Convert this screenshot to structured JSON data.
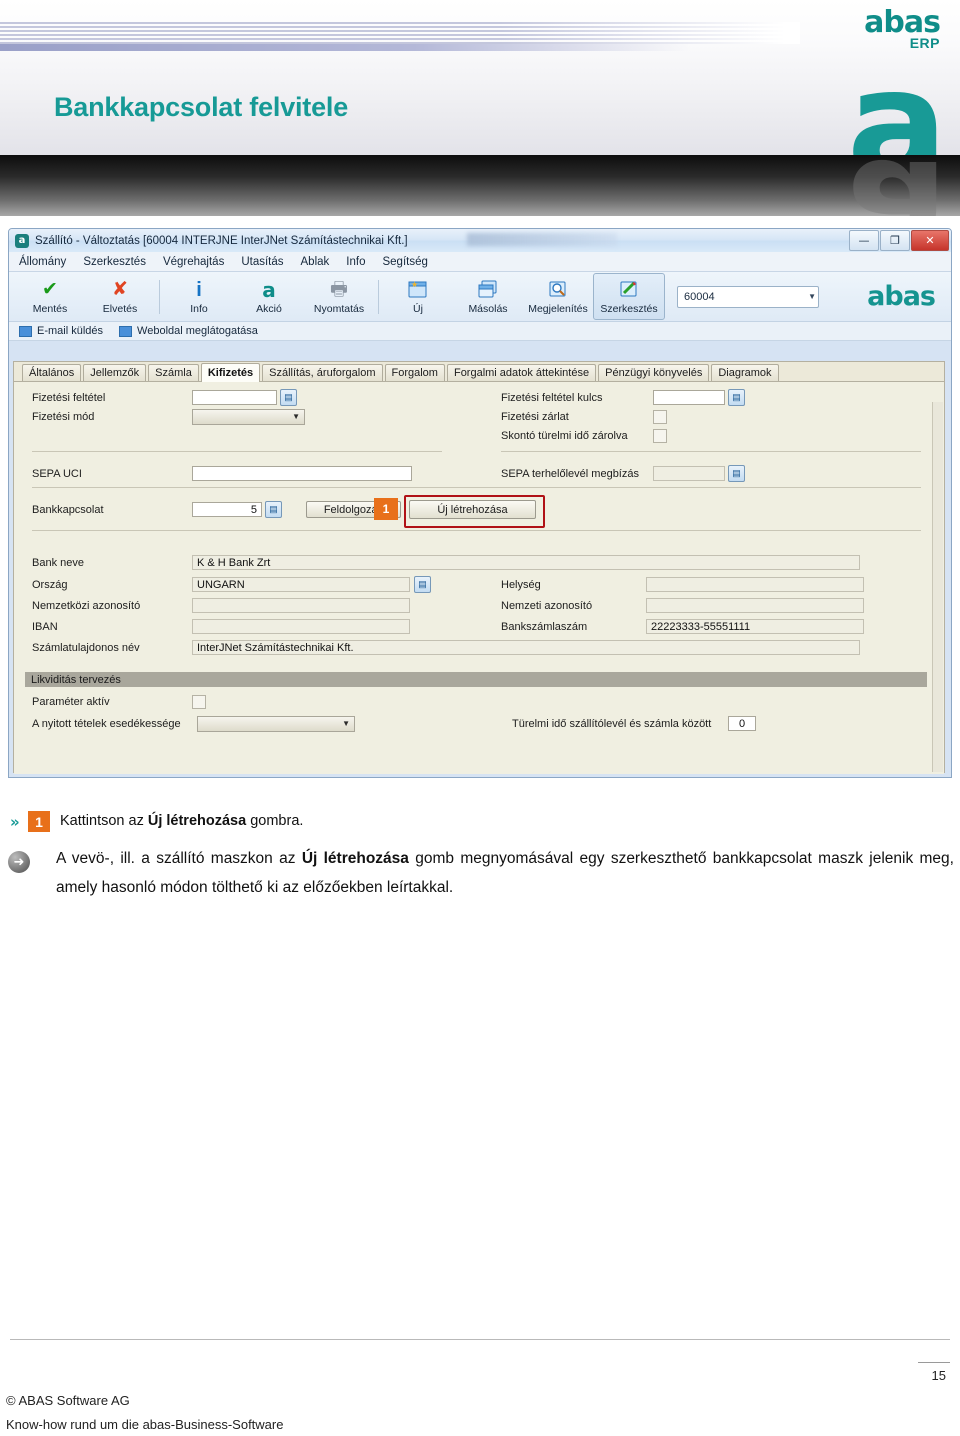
{
  "banner": {
    "title": "Bankkapcsolat felvitele",
    "logo_word": "abas",
    "logo_sub": "ERP",
    "logo_letter": "a"
  },
  "app": {
    "title": "Szállító - Változtatás  [60004   INTERJNE   InterJNet Számítástechnikai Kft.]",
    "window_buttons": [
      {
        "name": "minimize",
        "glyph": "—"
      },
      {
        "name": "maximize",
        "glyph": "❐"
      },
      {
        "name": "close",
        "glyph": "✕"
      }
    ],
    "menu": [
      "Állomány",
      "Szerkesztés",
      "Végrehajtás",
      "Utasítás",
      "Ablak",
      "Info",
      "Segítség"
    ],
    "toolbar": {
      "buttons": [
        {
          "label": "Mentés",
          "icon": "check-icon",
          "glyph": "✔",
          "color": "#1a9a1a",
          "selected": false
        },
        {
          "label": "Elvetés",
          "icon": "cross-icon",
          "glyph": "✘",
          "color": "#e04422",
          "selected": false
        },
        {
          "label": "Info",
          "icon": "info-icon",
          "glyph": "i",
          "color": "#1673c4",
          "selected": false
        },
        {
          "label": "Akció",
          "icon": "action-a-icon",
          "glyph": "a",
          "color": "#0f8d89",
          "selected": false
        },
        {
          "label": "Nyomtatás",
          "icon": "printer-icon",
          "glyph": "🖶",
          "color": "#7d8896",
          "selected": false
        },
        {
          "label": "Új",
          "icon": "new-document-icon",
          "glyph": "❏",
          "color": "#2f86d6",
          "selected": false
        },
        {
          "label": "Másolás",
          "icon": "copy-icon",
          "glyph": "❐",
          "color": "#2f86d6",
          "selected": false
        },
        {
          "label": "Megjelenítés",
          "icon": "magnifier-icon",
          "glyph": "🔍",
          "color": "#2f86d6",
          "selected": false
        },
        {
          "label": "Szerkesztés",
          "icon": "pencil-edit-icon",
          "glyph": "✎",
          "color": "#2f86d6",
          "selected": true
        }
      ],
      "record_combo_value": "60004",
      "logo": "abas"
    },
    "links": [
      {
        "label": "E-mail küldés",
        "icon": "mail-icon"
      },
      {
        "label": "Weboldal meglátogatása",
        "icon": "web-icon"
      }
    ],
    "tabs": [
      {
        "label": "Általános",
        "active": false
      },
      {
        "label": "Jellemzők",
        "active": false
      },
      {
        "label": "Számla",
        "active": false
      },
      {
        "label": "Kifizetés",
        "active": true
      },
      {
        "label": "Szállítás, áruforgalom",
        "active": false
      },
      {
        "label": "Forgalom",
        "active": false
      },
      {
        "label": "Forgalmi adatok áttekintése",
        "active": false
      },
      {
        "label": "Pénzügyi könyvelés",
        "active": false
      },
      {
        "label": "Diagramok",
        "active": false
      }
    ],
    "form": {
      "fizetesi_feltetel_label": "Fizetési feltétel",
      "fizetesi_feltetel_value": "",
      "fizetesi_mod_label": "Fizetési mód",
      "fizetesi_mod_value": "",
      "fizetesi_feltetel_kulcs_label": "Fizetési feltétel kulcs",
      "fizetesi_feltetel_kulcs_value": "",
      "fizetesi_zarlat_label": "Fizetési zárlat",
      "skonto_label": "Skontó türelmi idő zárolva",
      "sepa_uci_label": "SEPA UCI",
      "sepa_uci_value": "",
      "sepa_terhelolevel_label": "SEPA terhelőlevél megbízás",
      "sepa_terhelolevel_value": "",
      "bankkapcsolat_label": "Bankkapcsolat",
      "bankkapcsolat_value": "5",
      "feldolgozas_button": "Feldolgozás",
      "uj_letrehozasa_button": "Új létrehozása",
      "callout_number": "1",
      "bank_neve_label": "Bank neve",
      "bank_neve_value": "K & H Bank Zrt",
      "orszag_label": "Ország",
      "orszag_value": "UNGARN",
      "helyseg_label": "Helység",
      "helyseg_value": "",
      "nemzetkozi_azonosito_label": "Nemzetközi azonosító",
      "nemzetkozi_azonosito_value": "",
      "nemzeti_azonosito_label": "Nemzeti azonosító",
      "nemzeti_azonosito_value": "",
      "iban_label": "IBAN",
      "iban_value": "",
      "bankszamlaszam_label": "Bankszámlaszám",
      "bankszamlaszam_value": "22223333-55551111",
      "szamlatulajdonos_label": "Számlatulajdonos név",
      "szamlatulajdonos_value": "InterJNet Számítástechnikai Kft.",
      "likviditas_section": "Likviditás tervezés",
      "parameter_aktiv_label": "Paraméter aktív",
      "nyitott_tetelek_label": "A nyitott tételek esedékessége",
      "nyitott_tetelek_value": "",
      "turelmi_ido_label": "Türelmi idő szállítólevél és számla között",
      "turelmi_ido_value": "0"
    }
  },
  "instructions": {
    "step_number": "1",
    "step_pre": "Kattintson  az ",
    "step_bold": "Új létrehozása",
    "step_post": " gombra.",
    "para_1": "A vevö-, ill. a szállító maszkon az ",
    "para_bold": "Új létrehozása",
    "para_2": " gomb megnyomásával egy szerkeszthető bankkapcsolat maszk jelenik meg, amely hasonló módon tölthető ki az előzőekben leírtakkal."
  },
  "footer": {
    "page_number": "15",
    "copyright": "© ABAS  Software  AG",
    "tagline": "Know-how  rund  um  die  abas-Business-Software"
  }
}
